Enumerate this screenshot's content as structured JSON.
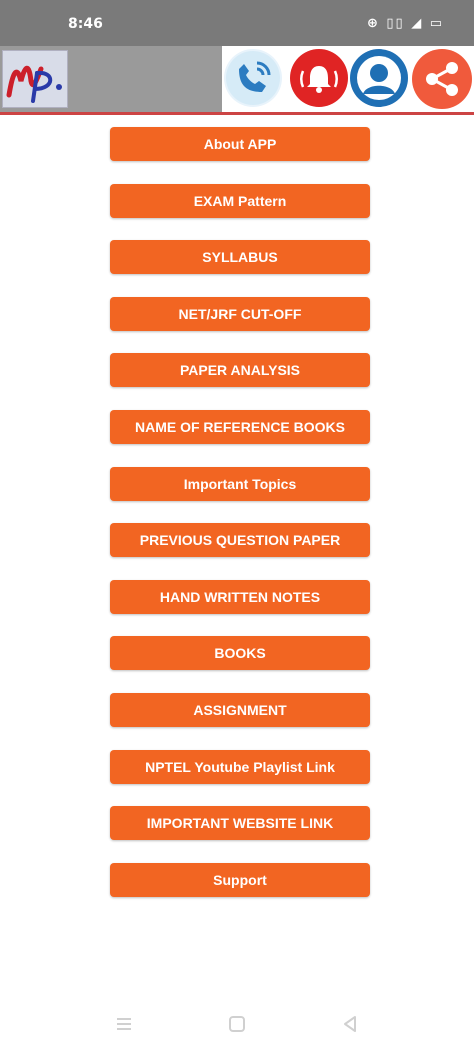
{
  "status_bar": {
    "time": "8:46",
    "indicators": "⊕ ▯▯ ◢ ▭",
    "icon_color": "#ffffff"
  },
  "app_bar": {
    "logo_text": "MP",
    "accent_color": "#cc4444",
    "icons": [
      "phone-icon",
      "bell-icon",
      "user-icon",
      "share-icon"
    ]
  },
  "menu": {
    "color": "#f26522",
    "items": [
      {
        "label": "About APP"
      },
      {
        "label": "EXAM Pattern"
      },
      {
        "label": "SYLLABUS"
      },
      {
        "label": "NET/JRF CUT-OFF"
      },
      {
        "label": "PAPER ANALYSIS"
      },
      {
        "label": "NAME OF REFERENCE BOOKS"
      },
      {
        "label": "Important Topics"
      },
      {
        "label": "PREVIOUS QUESTION PAPER"
      },
      {
        "label": "HAND WRITTEN NOTES"
      },
      {
        "label": "BOOKS"
      },
      {
        "label": "ASSIGNMENT"
      },
      {
        "label": "NPTEL  Youtube Playlist Link"
      },
      {
        "label": "IMPORTANT WEBSITE LINK"
      },
      {
        "label": "Support"
      }
    ]
  },
  "nav_bar": {
    "icons": [
      "menu-icon",
      "home-icon",
      "back-icon"
    ]
  }
}
